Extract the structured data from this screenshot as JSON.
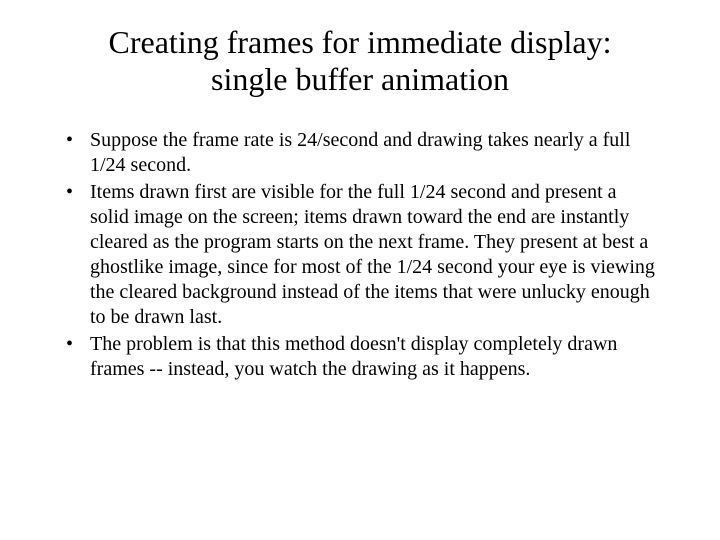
{
  "title_line1": "Creating frames for immediate display:",
  "title_line2": "single buffer animation",
  "bullets": [
    "Suppose the frame rate is 24/second and drawing takes nearly a full 1/24 second.",
    "Items drawn first are visible for the full 1/24 second and present a solid image on the screen; items drawn toward the end are instantly cleared as the program starts on the next frame. They present at best a ghostlike image, since for most of the 1/24 second your eye is viewing the cleared background instead of the items that were unlucky enough to be drawn last.",
    "The problem is that this method doesn't display completely drawn frames -- instead, you watch the drawing as it happens."
  ]
}
